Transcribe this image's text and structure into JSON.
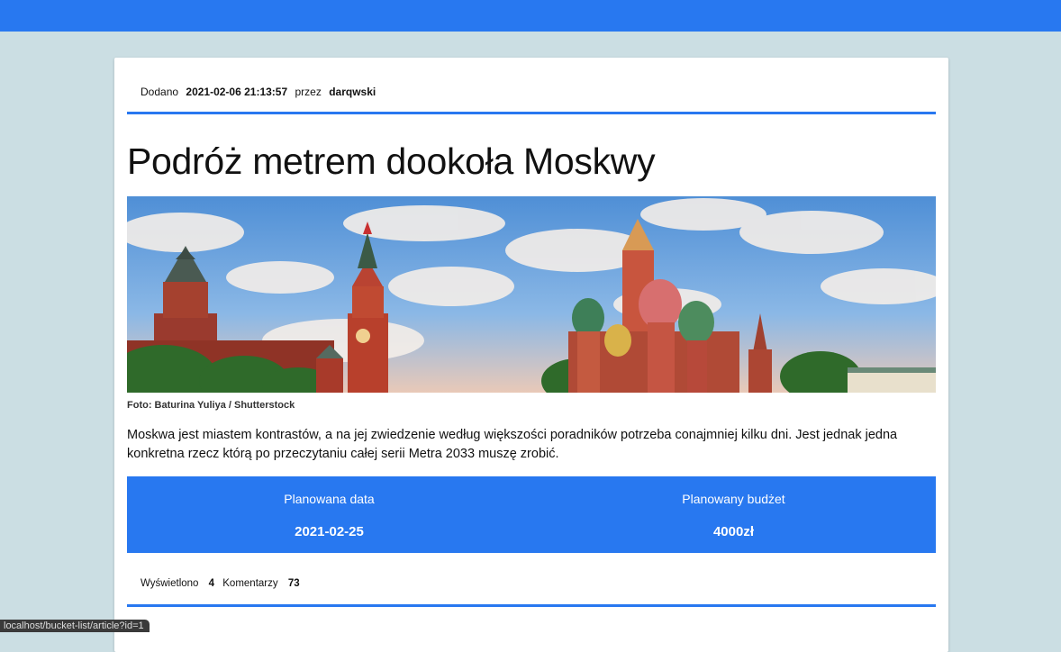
{
  "colors": {
    "accent": "#2878f0",
    "page_bg": "#cbdee3"
  },
  "article": {
    "meta": {
      "added_label": "Dodano",
      "date": "2021-02-06 21:13:57",
      "by_label": "przez",
      "author": "darqwski"
    },
    "title": "Podróż metrem dookoła Moskwy",
    "image_caption": "Foto: Baturina Yuliya / Shutterstock",
    "lead": "Moskwa jest miastem kontrastów, a na jej zwiedzenie według większości poradników potrzeba conajmniej kilku dni. Jest jednak jedna konkretna rzecz którą po przeczytaniu całej serii Metra 2033 muszę zrobić.",
    "planned_date_label": "Planowana data",
    "planned_date": "2021-02-25",
    "planned_budget_label": "Planowany budżet",
    "planned_budget": "4000zł",
    "views_label": "Wyświetlono",
    "views": "4",
    "comments_label": "Komentarzy",
    "comments": "73"
  },
  "statusbar": {
    "url": "localhost/bucket-list/article?id=1"
  }
}
